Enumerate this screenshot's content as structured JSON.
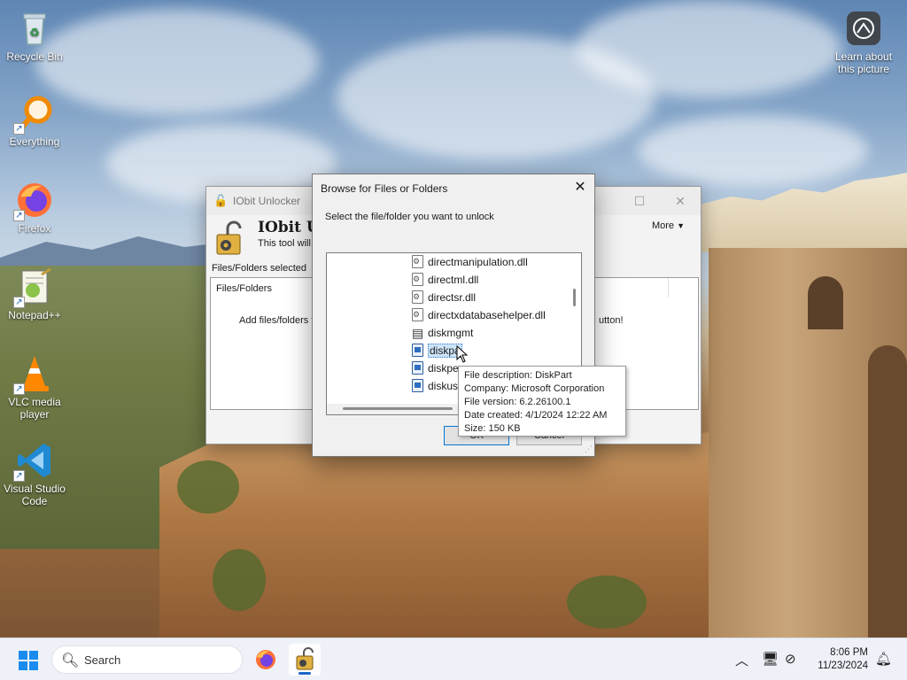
{
  "desktop": {
    "icons": [
      {
        "label": "Recycle Bin",
        "icon": "recycle-bin-icon"
      },
      {
        "label": "Everything",
        "icon": "everything-search-icon"
      },
      {
        "label": "Firefox",
        "icon": "firefox-icon"
      },
      {
        "label": "Notepad++",
        "icon": "notepad-plus-plus-icon"
      },
      {
        "label": "VLC media player",
        "icon": "vlc-cone-icon"
      },
      {
        "label": "Visual Studio Code",
        "icon": "vscode-icon"
      }
    ],
    "spotlight_label": "Learn about this picture"
  },
  "iobit_window": {
    "title": "IObit Unlocker",
    "header_title": "IObit Ur",
    "header_desc": "This tool will l",
    "more_label": "More",
    "files_selected_label": "Files/Folders selected",
    "column_header": "Files/Folders",
    "empty_hint_left": "Add files/folders t",
    "empty_hint_right": "utton!"
  },
  "browse_dialog": {
    "title": "Browse for Files or Folders",
    "prompt": "Select the file/folder you want to unlock",
    "items": [
      {
        "name": "directmanipulation.dll",
        "type": "dll"
      },
      {
        "name": "directml.dll",
        "type": "dll"
      },
      {
        "name": "directsr.dll",
        "type": "dll"
      },
      {
        "name": "directxdatabasehelper.dll",
        "type": "dll"
      },
      {
        "name": "diskmgmt",
        "type": "mmc"
      },
      {
        "name": "diskpa",
        "type": "exe",
        "selected": true
      },
      {
        "name": "diskpe",
        "type": "exe"
      },
      {
        "name": "diskus",
        "type": "exe"
      }
    ],
    "ok_label": "OK",
    "cancel_label": "Cancel"
  },
  "tooltip": {
    "description": "File description: DiskPart",
    "company": "Company: Microsoft Corporation",
    "version": "File version: 6.2.26100.1",
    "created": "Date created: 4/1/2024 12:22 AM",
    "size": "Size: 150 KB"
  },
  "taskbar": {
    "search_placeholder": "Search",
    "time": "8:06 PM",
    "date": "11/23/2024",
    "accent": "#1a66c7"
  }
}
